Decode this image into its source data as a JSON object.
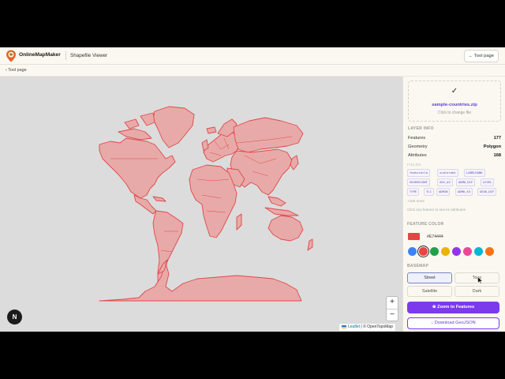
{
  "header": {
    "brand": "OnlineMapMaker",
    "page_title": "Shapefile Viewer",
    "tool_page_button": "← Tool page"
  },
  "subheader": {
    "back_link": "‹  Tool page"
  },
  "map": {
    "zoom_in": "+",
    "zoom_out": "−",
    "attribution_leaflet": "Leaflet",
    "attribution_rest": " | © OpenTopoMap",
    "feature_fill": "#E74444",
    "background": "#dcdcdc"
  },
  "fab_label": "N",
  "upload": {
    "check_icon": "✓",
    "file_name": "sample-countries.zip",
    "hint": "Click to change file"
  },
  "layer_info": {
    "heading": "LAYER INFO",
    "rows": [
      {
        "key": "Features",
        "value": "177"
      },
      {
        "key": "Geometry",
        "value": "Polygon"
      },
      {
        "key": "Attributes",
        "value": "168"
      }
    ],
    "fields_label": "FIELDS",
    "fields": [
      "featurecla",
      "scalerank",
      "LABELRANK",
      "SOVEREIGNT",
      "SOV_A3",
      "ADM0_DIF",
      "LEVEL",
      "TYPE",
      "TLC",
      "ADMIN",
      "ADM0_A3",
      "GEOU_DIF"
    ],
    "more": "+156 more",
    "click_hint": "Click any feature to see its attributes"
  },
  "feature_color": {
    "heading": "FEATURE COLOR",
    "hex": "#E74444",
    "value": "#e74444",
    "presets": [
      "#3b82f6",
      "#e74444",
      "#22a04b",
      "#eab308",
      "#9333ea",
      "#ec4899",
      "#06b6d4",
      "#f97316"
    ],
    "selected_index": 1
  },
  "basemap": {
    "heading": "BASEMAP",
    "options": [
      "Street",
      "Topo",
      "Satellite",
      "Dark"
    ],
    "active": "Street"
  },
  "actions": {
    "zoom_to_features": "⊕ Zoom to Features",
    "download_geojson": "↓ Download GeoJSON"
  }
}
